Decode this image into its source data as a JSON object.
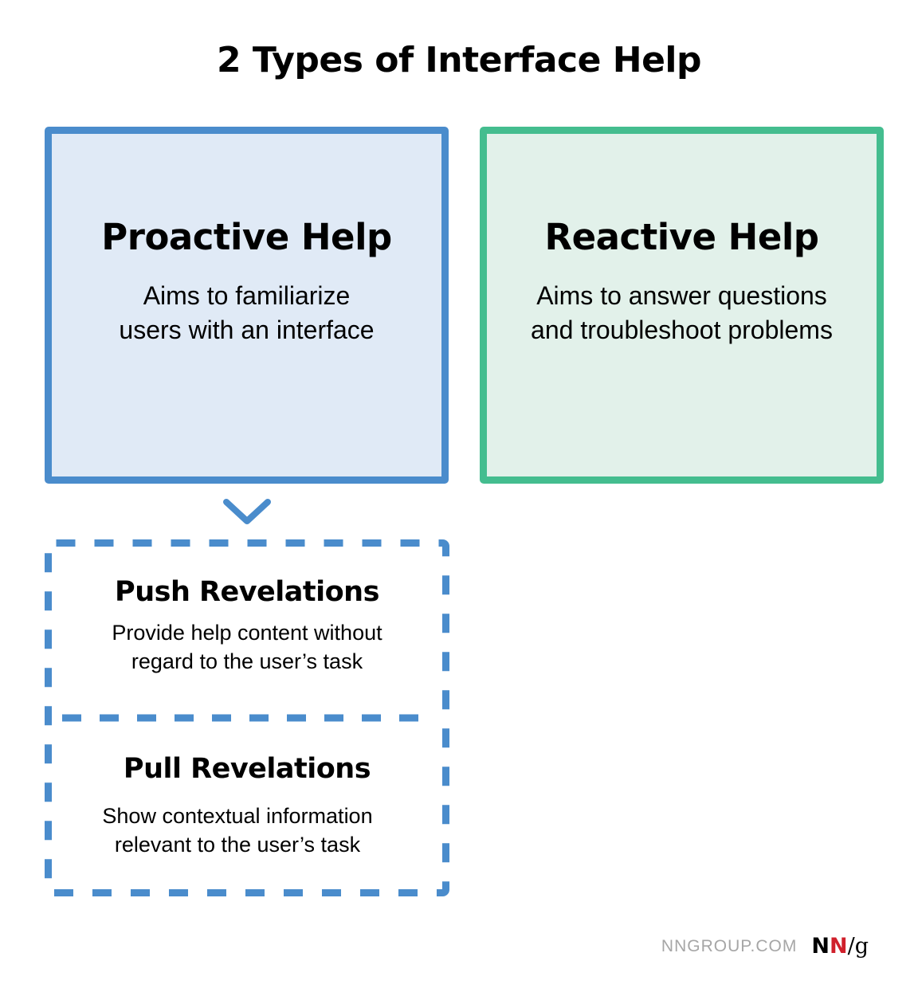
{
  "title": "2 Types of Interface Help",
  "colors": {
    "proactive_border": "#4a8ccc",
    "proactive_fill": "#e0eaf6",
    "reactive_border": "#44bd8f",
    "reactive_fill": "#e2f1ea",
    "dashed_border": "#4a8ccc",
    "logo_red": "#d0202b",
    "footer_gray": "#a6a6a6"
  },
  "boxes": [
    {
      "title": "Proactive Help",
      "description_lines": [
        "Aims to familiarize",
        "users with an interface"
      ]
    },
    {
      "title": "Reactive Help",
      "description_lines": [
        "Aims to answer questions",
        "and troubleshoot problems"
      ]
    }
  ],
  "connector": {
    "icon": "chevron-down-icon"
  },
  "subtypes": [
    {
      "title": "Push Revelations",
      "description_lines": [
        "Provide help content without",
        "regard to the user’s task"
      ]
    },
    {
      "title": "Pull Revelations",
      "description_lines": [
        "Show contextual information",
        "relevant to the user’s task"
      ]
    }
  ],
  "footer": {
    "site": "NNGROUP.COM",
    "logo": {
      "n1": "N",
      "n2": "N",
      "slash": "/",
      "g": "g"
    }
  }
}
